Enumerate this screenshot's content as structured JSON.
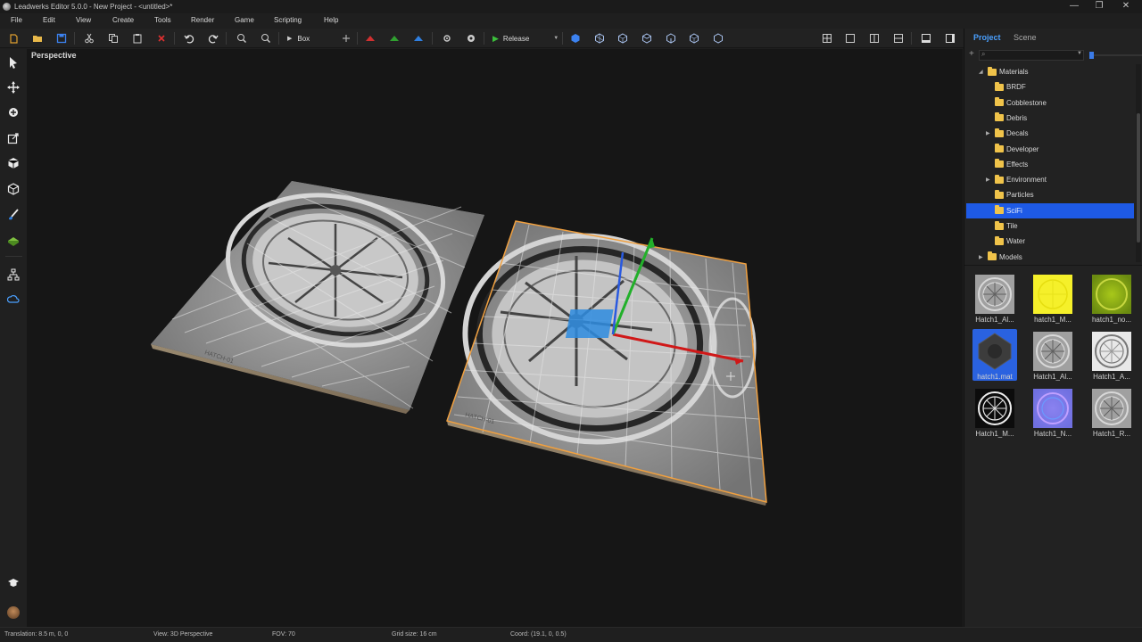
{
  "window": {
    "title": "Leadwerks Editor 5.0.0 - New Project - <untitled>*",
    "minimize": "—",
    "restore": "❐",
    "close": "✕"
  },
  "menu": [
    "File",
    "Edit",
    "View",
    "Create",
    "Tools",
    "Render",
    "Game",
    "Scripting",
    "Help"
  ],
  "toolbar": {
    "primitive": "Box",
    "build_config": "Release"
  },
  "viewport": {
    "label": "Perspective"
  },
  "panel": {
    "tabs": [
      {
        "label": "Project",
        "active": true
      },
      {
        "label": "Scene",
        "active": false
      }
    ],
    "search_placeholder": ""
  },
  "tree": [
    {
      "label": "Materials",
      "level": 0,
      "expanded": true,
      "has_children": true,
      "selected": false
    },
    {
      "label": "BRDF",
      "level": 1,
      "has_children": false,
      "selected": false
    },
    {
      "label": "Cobblestone",
      "level": 1,
      "has_children": false,
      "selected": false
    },
    {
      "label": "Debris",
      "level": 1,
      "has_children": false,
      "selected": false
    },
    {
      "label": "Decals",
      "level": 1,
      "has_children": true,
      "selected": false
    },
    {
      "label": "Developer",
      "level": 1,
      "has_children": false,
      "selected": false
    },
    {
      "label": "Effects",
      "level": 1,
      "has_children": false,
      "selected": false
    },
    {
      "label": "Environment",
      "level": 1,
      "has_children": true,
      "selected": false
    },
    {
      "label": "Particles",
      "level": 1,
      "has_children": false,
      "selected": false
    },
    {
      "label": "SciFi",
      "level": 1,
      "has_children": false,
      "selected": true
    },
    {
      "label": "Tile",
      "level": 1,
      "has_children": false,
      "selected": false
    },
    {
      "label": "Water",
      "level": 1,
      "has_children": false,
      "selected": false
    },
    {
      "label": "Models",
      "level": 0,
      "expanded": false,
      "has_children": true,
      "selected": false
    }
  ],
  "assets": [
    {
      "name": "Hatch1_Al...",
      "kind": "hatch-gray",
      "selected": false
    },
    {
      "name": "hatch1_M...",
      "kind": "yellow",
      "selected": false
    },
    {
      "name": "hatch1_no...",
      "kind": "green",
      "selected": false
    },
    {
      "name": "hatch1.mat",
      "kind": "material-dark",
      "selected": true
    },
    {
      "name": "Hatch1_Al...",
      "kind": "hatch-gray",
      "selected": false
    },
    {
      "name": "Hatch1_A...",
      "kind": "hatch-white",
      "selected": false
    },
    {
      "name": "Hatch1_M...",
      "kind": "hatch-black",
      "selected": false
    },
    {
      "name": "Hatch1_N...",
      "kind": "normal",
      "selected": false
    },
    {
      "name": "Hatch1_R...",
      "kind": "hatch-gray",
      "selected": false
    }
  ],
  "status": {
    "translation": "Translation: 8.5 m, 0, 0",
    "view": "View: 3D Perspective",
    "fov": "FOV: 70",
    "grid": "Grid size: 16 cm",
    "coord": "Coord: (19.1, 0, 0.5)"
  },
  "colors": {
    "accent": "#3b7be8",
    "selection": "#1e5ae6",
    "folder": "#f0c34a",
    "outline": "#f0a040"
  }
}
